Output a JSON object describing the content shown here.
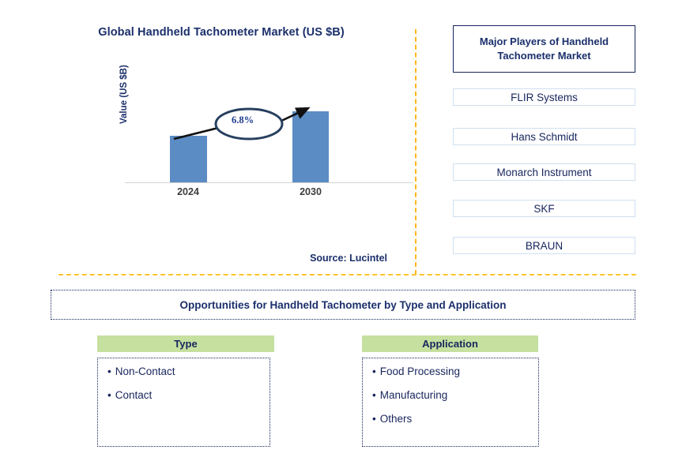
{
  "chart_panel": {
    "title": "Global Handheld Tachometer Market (US $B)",
    "ylabel": "Value (US $B)",
    "growth_label": "6.8%",
    "source": "Source: Lucintel",
    "ticks": {
      "first": "2024",
      "second": "2030"
    }
  },
  "players": {
    "header": "Major Players of Handheld Tachometer Market",
    "items": [
      {
        "label": "FLIR Systems"
      },
      {
        "label": "Hans Schmidt"
      },
      {
        "label": "Monarch Instrument"
      },
      {
        "label": "SKF"
      },
      {
        "label": "BRAUN"
      }
    ]
  },
  "opportunities": {
    "banner": "Opportunities for Handheld Tachometer by Type and Application",
    "segments": [
      {
        "header": "Type",
        "items": [
          "Non-Contact",
          "Contact"
        ]
      },
      {
        "header": "Application",
        "items": [
          "Food Processing",
          "Manufacturing",
          "Others"
        ]
      }
    ]
  },
  "bullet_glyph": "•",
  "colors": {
    "bar": "#5b8cc4",
    "navy": "#17255c",
    "title_blue": "#1b2f6b",
    "divider_orange": "#ffb81c",
    "segment_header_green": "#c6e0a0",
    "player_border": "#cfe0f0"
  },
  "chart_data": {
    "type": "bar",
    "title": "Global Handheld Tachometer Market (US $B)",
    "xlabel": "",
    "ylabel": "Value (US $B)",
    "categories": [
      "2024",
      "2030"
    ],
    "values": [
      59,
      90
    ],
    "value_units": "relative bar height (px, unlabeled axis)",
    "ylim": [
      0,
      100
    ],
    "grid": false,
    "legend": false,
    "annotations": [
      {
        "text": "6.8%",
        "type": "cagr-callout",
        "from": "2024",
        "to": "2030"
      }
    ],
    "series": [
      {
        "name": "Market value",
        "values": [
          59,
          90
        ]
      }
    ]
  }
}
